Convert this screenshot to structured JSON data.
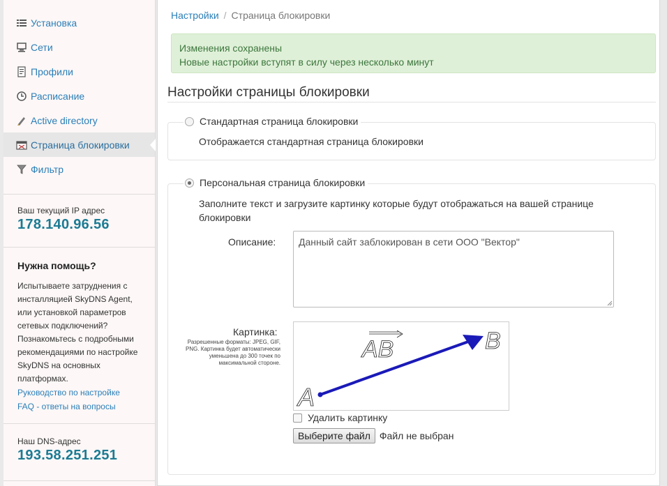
{
  "sidebar": {
    "items": [
      {
        "label": "Установка",
        "icon": "install-list-icon"
      },
      {
        "label": "Сети",
        "icon": "network-icon"
      },
      {
        "label": "Профили",
        "icon": "profile-icon"
      },
      {
        "label": "Расписание",
        "icon": "clock-icon"
      },
      {
        "label": "Active directory",
        "icon": "active-directory-icon"
      },
      {
        "label": "Страница блокировки",
        "icon": "block-page-icon",
        "active": true
      },
      {
        "label": "Фильтр",
        "icon": "filter-icon"
      }
    ],
    "ip_label": "Ваш текущий IP адрес",
    "ip_value": "178.140.96.56",
    "help_title": "Нужна помощь?",
    "help_text": "Испытываете затруднения с инсталляцией SkyDNS Agent, или установкой параметров сетевых подключений? Познакомьтесь с подробными рекомендациями по настройке SkyDNS на основных платформах.",
    "help_link_guide": "Руководство по настройке",
    "help_link_faq": "FAQ - ответы на вопросы",
    "dns_label": "Наш DNS-адрес",
    "dns_value": "193.58.251.251"
  },
  "breadcrumb": {
    "parent": "Настройки",
    "separator": "/",
    "current": "Страница блокировки"
  },
  "alert": {
    "line1": "Изменения сохранены",
    "line2": "Новые настройки вступят в силу через несколько минут",
    "color": "#3c763d"
  },
  "page_title": "Настройки страницы блокировки",
  "standard_option": {
    "label": "Стандартная страница блокировки",
    "description": "Отображается стандартная страница блокировки",
    "selected": false
  },
  "custom_option": {
    "label": "Персональная страница блокировки",
    "description": "Заполните текст и загрузите картинку которые будут отображаться на вашей странице блокировки",
    "selected": true,
    "description_label": "Описание:",
    "description_value": "Данный сайт заблокирован в сети ООО \"Вектор\"",
    "picture_label": "Картинка:",
    "picture_note": "Разрешенные форматы: JPEG, GIF, PNG. Картинка будет автоматически уменьшена до 300 точек по максимальной стороне.",
    "picture_text_ab": "AB",
    "picture_text_a": "A",
    "picture_text_b": "B",
    "delete_label": "Удалить картинку",
    "delete_checked": false,
    "file_button": "Выберите файл",
    "file_status": "Файл не выбран"
  },
  "colors": {
    "link": "#2a7fb8",
    "ip": "#1b7b93",
    "arrow": "#1a1ab8"
  }
}
